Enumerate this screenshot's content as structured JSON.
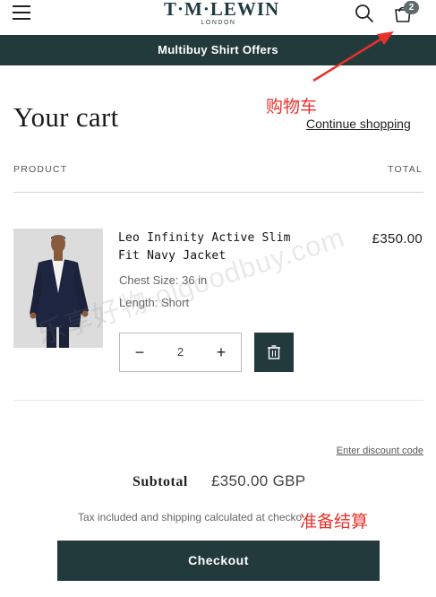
{
  "header": {
    "logo_main": "T·M·LEWIN",
    "logo_sub": "LONDON",
    "cart_count": "2"
  },
  "announcement": "Multibuy Shirt Offers",
  "annotations": {
    "cart": "购物车",
    "checkout": "准备结算",
    "watermark": "乐享好物 olgoodbuy.com",
    "color": "#e8312a"
  },
  "cart": {
    "title": "Your cart",
    "continue_label": "Continue shopping",
    "columns": {
      "product": "PRODUCT",
      "total": "TOTAL"
    },
    "items": [
      {
        "name_line1": "Leo Infinity Active Slim",
        "name_line2": "Fit Navy Jacket",
        "attributes": [
          "Chest Size: 36 in",
          "Length: Short"
        ],
        "price": "£350.00",
        "quantity": "2",
        "minus_label": "−",
        "plus_label": "+"
      }
    ],
    "discount_label": "Enter discount code",
    "subtotal_label": "Subtotal",
    "subtotal_value": "£350.00 GBP",
    "tax_note": "Tax included and shipping calculated at checkout",
    "checkout_label": "Checkout"
  },
  "colors": {
    "brand_dark": "#233a3d",
    "badge": "#5f6b69"
  }
}
